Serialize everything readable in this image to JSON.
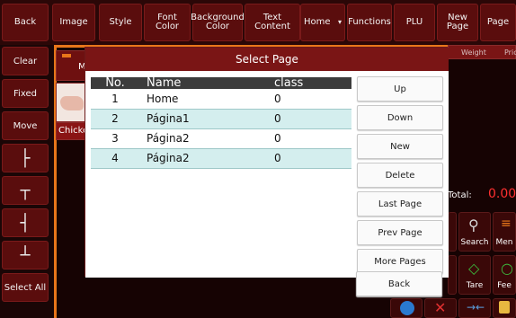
{
  "toolbar": {
    "back": "Back",
    "image": "Image",
    "style": "Style",
    "font_color": "Font Color",
    "background_color_line1": "Background",
    "background_color_line2": "Color",
    "text_content": "Text Content",
    "home": "Home",
    "home_caret": "▾",
    "functions": "Functions",
    "plu": "PLU",
    "new_page_line1": "New",
    "new_page_line2": "Page",
    "page": "Page"
  },
  "sidebar": {
    "clear": "Clear",
    "fixed": "Fixed",
    "move": "Move",
    "align_left": "├",
    "align_top": "┬",
    "align_right": "┤",
    "align_bottom": "┴",
    "select_all": "Select All"
  },
  "background": {
    "item_label": "M",
    "item_name": "Chicke",
    "weight_header": "Weight",
    "price_header": "Pric",
    "total_label": "Total:",
    "total_value": "0.00",
    "search_label": "Search",
    "menu_label": "Men",
    "tare_label": "Tare",
    "feed_label": "Fee"
  },
  "dialog": {
    "title": "Select Page",
    "columns": {
      "no": "No.",
      "name": "Name",
      "class": "class"
    },
    "rows": [
      {
        "no": "1",
        "name": "Home",
        "class": "0"
      },
      {
        "no": "2",
        "name": "Página1",
        "class": "0"
      },
      {
        "no": "3",
        "name": "Página2",
        "class": "0"
      },
      {
        "no": "4",
        "name": "Página2",
        "class": "0"
      }
    ],
    "buttons": {
      "up": "Up",
      "down": "Down",
      "new": "New",
      "delete": "Delete",
      "last_page": "Last Page",
      "prev_page": "Prev Page",
      "more_pages": "More Pages",
      "back": "Back"
    }
  },
  "colors": {
    "accent": "#e8761a",
    "toolbar_button": "#5a0d0d",
    "dialog_title": "#7a1515",
    "row_alt": "#d4eeee",
    "total_value": "#ff3030"
  }
}
